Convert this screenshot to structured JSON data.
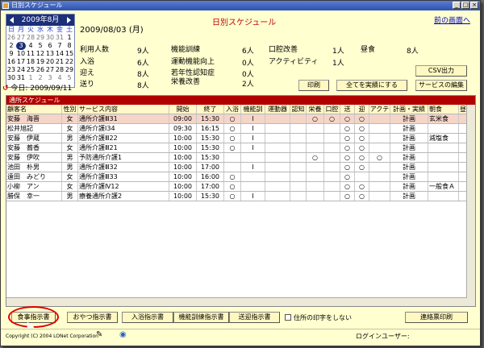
{
  "window": {
    "title": "日別スケジュール"
  },
  "calendar": {
    "month_label": "2009年8月",
    "weekdays": [
      "日",
      "月",
      "火",
      "水",
      "木",
      "金",
      "土"
    ],
    "days": [
      [
        "26",
        "27",
        "28",
        "29",
        "30",
        "31",
        "1"
      ],
      [
        "2",
        "3",
        "4",
        "5",
        "6",
        "7",
        "8"
      ],
      [
        "9",
        "10",
        "11",
        "12",
        "13",
        "14",
        "15"
      ],
      [
        "16",
        "17",
        "18",
        "19",
        "20",
        "21",
        "22"
      ],
      [
        "23",
        "24",
        "25",
        "26",
        "27",
        "28",
        "29"
      ],
      [
        "30",
        "31",
        "1",
        "2",
        "3",
        "4",
        "5"
      ]
    ],
    "selected_day": "3",
    "today_label": "今日: 2009/09/11"
  },
  "header": {
    "date": "2009/08/03 (月)",
    "title": "日別スケジュール",
    "prev_link": "前の画面へ"
  },
  "stats": {
    "s1_label": "利用人数",
    "s1_value": "9人",
    "s2_label": "入浴",
    "s2_value": "6人",
    "s3_label": "迎え",
    "s3_value": "8人",
    "s4_label": "送り",
    "s4_value": "8人",
    "s5_label": "機能訓練",
    "s5_value": "6人",
    "s6_label": "運動機能向上",
    "s6_value": "0人",
    "s7_label": "若年性認知症",
    "s7_value": "0人",
    "s8_label": "栄養改善",
    "s8_value": "2人",
    "s9_label": "口腔改善",
    "s9_value": "1人",
    "s10_label": "アクティビティ",
    "s10_value": "1人",
    "s11_label": "昼食",
    "s11_value": "8人"
  },
  "buttons": {
    "csv": "CSV出力",
    "print": "印刷",
    "execute_all": "全てを実績にする",
    "service_edit": "サービスの編集"
  },
  "table": {
    "panel_title": "通所スケジュール",
    "headers": [
      "顧客名",
      "性別",
      "サービス内容",
      "開始",
      "終了",
      "入浴",
      "機能訓",
      "運動器",
      "認知",
      "栄養",
      "口腔",
      "送",
      "迎",
      "アクテ",
      "計画・実績",
      "朝食",
      "昼"
    ],
    "rows": [
      {
        "name": "安藤　海晋",
        "sex": "女",
        "service": "通所介護Ⅲ31",
        "start": "09:00",
        "end": "15:30",
        "c1": "○",
        "c2": "Ⅰ",
        "c3": "",
        "c4": "",
        "c5": "○",
        "c6": "○",
        "c7": "○",
        "c8": "○",
        "c9": "",
        "plan": "計画",
        "breakfast": "玄米食",
        "lunch": ""
      },
      {
        "name": "松井旭記",
        "sex": "女",
        "service": "通所介護Ⅰ34",
        "start": "09:30",
        "end": "16:15",
        "c1": "○",
        "c2": "Ⅰ",
        "c3": "",
        "c4": "",
        "c5": "",
        "c6": "",
        "c7": "○",
        "c8": "○",
        "c9": "",
        "plan": "計画",
        "breakfast": "",
        "lunch": ""
      },
      {
        "name": "安藤　伊蔵",
        "sex": "男",
        "service": "通所介護Ⅲ22",
        "start": "10:00",
        "end": "15:30",
        "c1": "○",
        "c2": "Ⅰ",
        "c3": "",
        "c4": "",
        "c5": "",
        "c6": "",
        "c7": "○",
        "c8": "○",
        "c9": "",
        "plan": "計画",
        "breakfast": "減塩食",
        "lunch": ""
      },
      {
        "name": "安藤　蕎香",
        "sex": "女",
        "service": "通所介護Ⅲ21",
        "start": "10:00",
        "end": "15:30",
        "c1": "○",
        "c2": "Ⅰ",
        "c3": "",
        "c4": "",
        "c5": "",
        "c6": "",
        "c7": "○",
        "c8": "○",
        "c9": "",
        "plan": "計画",
        "breakfast": "",
        "lunch": ""
      },
      {
        "name": "安藤　伊吹",
        "sex": "男",
        "service": "予防通所介護1",
        "start": "10:00",
        "end": "15:30",
        "c1": "",
        "c2": "",
        "c3": "",
        "c4": "",
        "c5": "○",
        "c6": "",
        "c7": "○",
        "c8": "○",
        "c9": "○",
        "plan": "計画",
        "breakfast": "",
        "lunch": ""
      },
      {
        "name": "池田　朴男",
        "sex": "男",
        "service": "通所介護Ⅲ32",
        "start": "10:00",
        "end": "17:00",
        "c1": "",
        "c2": "Ⅰ",
        "c3": "",
        "c4": "",
        "c5": "",
        "c6": "",
        "c7": "○",
        "c8": "○",
        "c9": "",
        "plan": "計画",
        "breakfast": "",
        "lunch": ""
      },
      {
        "name": "遠田　みどり",
        "sex": "女",
        "service": "通所介護Ⅲ33",
        "start": "10:00",
        "end": "16:00",
        "c1": "○",
        "c2": "",
        "c3": "",
        "c4": "",
        "c5": "",
        "c6": "",
        "c7": "○",
        "c8": "",
        "c9": "",
        "plan": "計画",
        "breakfast": "",
        "lunch": ""
      },
      {
        "name": "小柳　アン",
        "sex": "女",
        "service": "通所介護Ⅳ12",
        "start": "10:00",
        "end": "17:00",
        "c1": "○",
        "c2": "",
        "c3": "",
        "c4": "",
        "c5": "",
        "c6": "",
        "c7": "○",
        "c8": "○",
        "c9": "",
        "plan": "計画",
        "breakfast": "一般食Ａ",
        "lunch": ""
      },
      {
        "name": "勝保　幸一",
        "sex": "男",
        "service": "療養通所介護2",
        "start": "10:00",
        "end": "15:30",
        "c1": "○",
        "c2": "Ⅰ",
        "c3": "",
        "c4": "",
        "c5": "",
        "c6": "",
        "c7": "○",
        "c8": "○",
        "c9": "",
        "plan": "計画",
        "breakfast": "",
        "lunch": ""
      }
    ]
  },
  "bottom": {
    "meal": "食事指示書",
    "snack": "おやつ指示書",
    "bath": "入浴指示書",
    "training": "機能訓練指示書",
    "transport": "送迎指示書",
    "no_address": "住所の印字をしない",
    "contact": "連絡票印刷",
    "copyright": "Copyright (C) 2004 LONet Corporation",
    "login": "ログインユーザー:"
  }
}
